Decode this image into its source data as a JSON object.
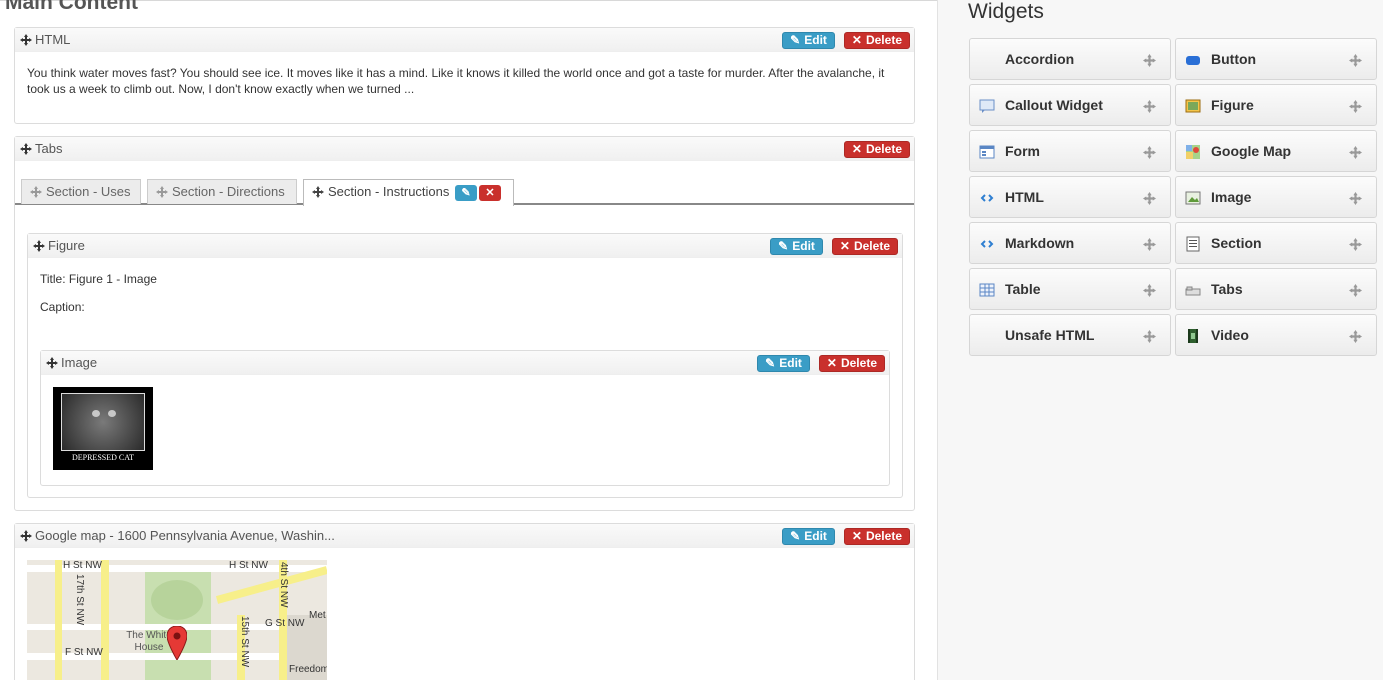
{
  "main": {
    "title": "Main Content",
    "html_widget": {
      "header": "HTML",
      "text": "You think water moves fast? You should see ice. It moves like it has a mind. Like it knows it killed the world once and got a taste for murder. After the avalanche, it took us a week to climb out. Now, I don't know exactly when we turned ..."
    },
    "tabs_widget": {
      "header": "Tabs",
      "tabs": [
        "Section - Uses",
        "Section - Directions",
        "Section - Instructions"
      ]
    },
    "figure_widget": {
      "header": "Figure",
      "title_line": "Title: Figure 1 - Image",
      "caption_line": "Caption:"
    },
    "image_widget": {
      "header": "Image",
      "image_caption": "DEPRESSED CAT"
    },
    "map_widget": {
      "header": "Google map - 1600 Pennsylvania Avenue, Washin...",
      "labels": [
        "H St NW",
        "H St NW",
        "17th St NW",
        "4th St NW",
        "G St NW",
        "F St NW",
        "The White House",
        "15th St NW",
        "Met",
        "Freedom"
      ]
    },
    "buttons": {
      "edit": "Edit",
      "delete": "Delete"
    }
  },
  "sidebar": {
    "title": "Widgets",
    "widgets": [
      {
        "label": "Accordion",
        "icon": "accordion-icon"
      },
      {
        "label": "Button",
        "icon": "button-icon"
      },
      {
        "label": "Callout Widget",
        "icon": "callout-icon"
      },
      {
        "label": "Figure",
        "icon": "figure-icon"
      },
      {
        "label": "Form",
        "icon": "form-icon"
      },
      {
        "label": "Google Map",
        "icon": "google-map-icon"
      },
      {
        "label": "HTML",
        "icon": "html-icon"
      },
      {
        "label": "Image",
        "icon": "image-icon"
      },
      {
        "label": "Markdown",
        "icon": "markdown-icon"
      },
      {
        "label": "Section",
        "icon": "section-icon"
      },
      {
        "label": "Table",
        "icon": "table-icon"
      },
      {
        "label": "Tabs",
        "icon": "tabs-icon"
      },
      {
        "label": "Unsafe HTML",
        "icon": "unsafe-html-icon"
      },
      {
        "label": "Video",
        "icon": "video-icon"
      }
    ]
  },
  "colors": {
    "edit": "#3a9dc6",
    "delete": "#c9302c",
    "sidebar_bg": "#f7f7f7"
  }
}
